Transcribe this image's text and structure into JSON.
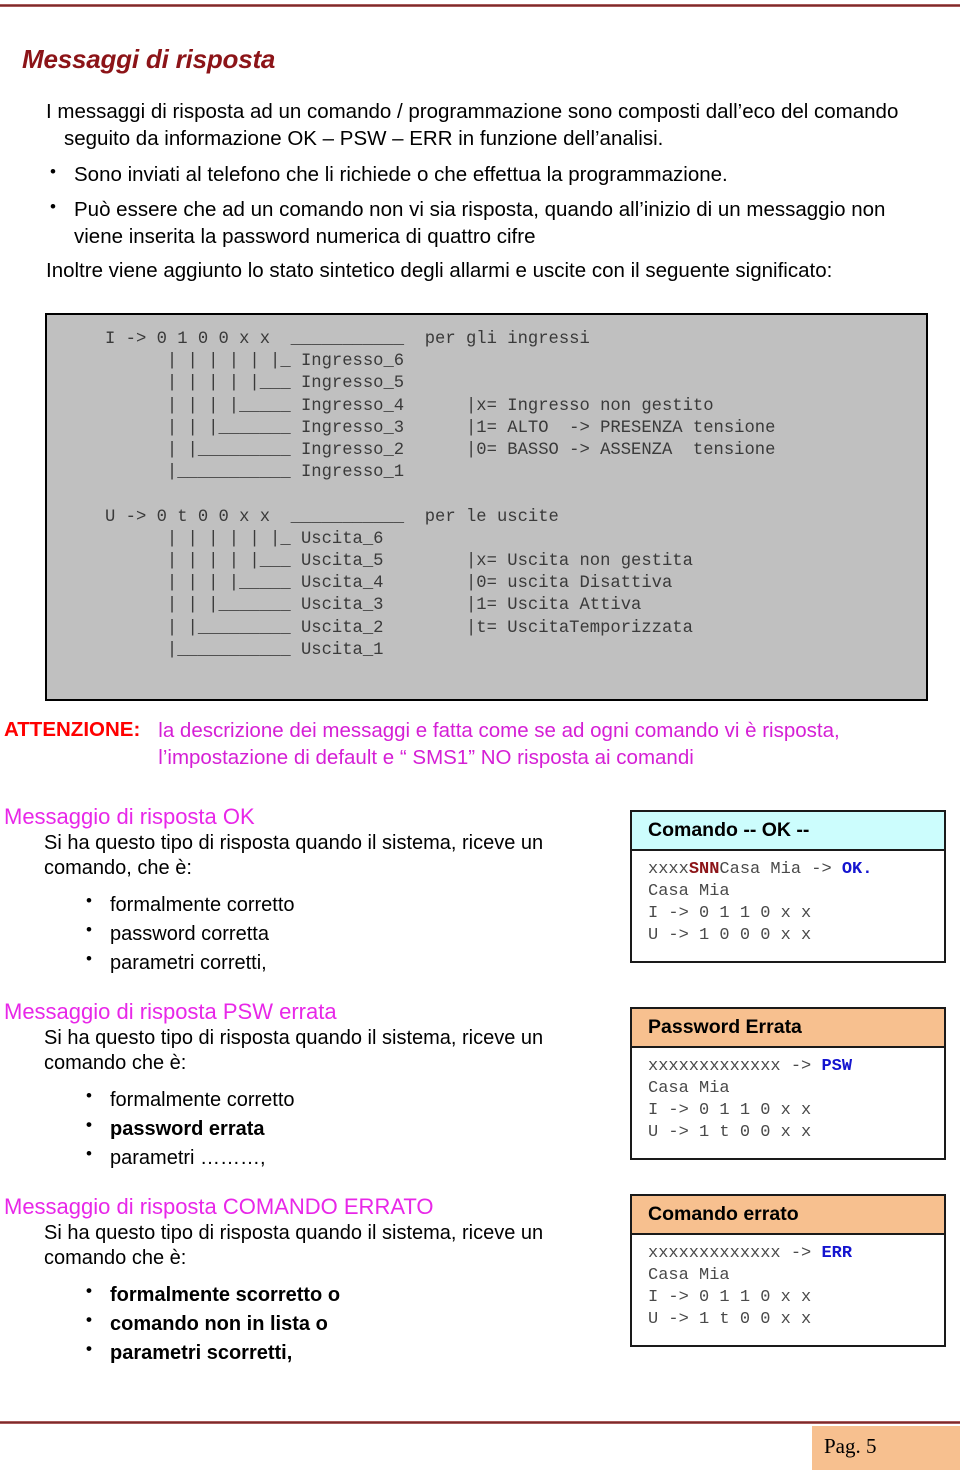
{
  "title": "Messaggi di risposta",
  "intro": {
    "paragraph_line1": "I messaggi di risposta ad un comando / programmazione sono composti dall’eco del comando",
    "paragraph_line2": "seguito da informazione OK – PSW – ERR  in funzione dell’analisi.",
    "bullets": [
      {
        "line1": "Sono inviati al telefono che li richiede o che effettua la programmazione.",
        "line2": ""
      },
      {
        "line1": "Può essere che ad un comando non vi sia risposta, quando all’inizio di un messaggio non",
        "line2": "viene inserita la password numerica di quattro cifre"
      }
    ],
    "closing": "Inoltre viene aggiunto lo stato sintetico degli allarmi e uscite con il seguente significato:"
  },
  "code_block": {
    "text": "I -> 0 1 0 0 x x  ___________  per gli ingressi\n      | | | | | |_ Ingresso_6\n      | | | | |___ Ingresso_5\n      | | | |_____ Ingresso_4      |x= Ingresso non gestito\n      | | |_______ Ingresso_3      |1= ALTO  -> PRESENZA tensione\n      | |_________ Ingresso_2      |0= BASSO -> ASSENZA  tensione\n      |___________ Ingresso_1\n\nU -> 0 t 0 0 x x  ___________  per le uscite\n      | | | | | |_ Uscita_6\n      | | | | |___ Uscita_5        |x= Uscita non gestita\n      | | | |_____ Uscita_4        |0= uscita Disattiva\n      | | |_______ Uscita_3        |1= Uscita Attiva\n      | |_________ Uscita_2        |t= UscitaTemporizzata\n      |___________ Uscita_1"
  },
  "attenzione": {
    "label": "ATTENZIONE:",
    "line1": "la descrizione dei messaggi e fatta come se ad ogni comando vi è risposta,",
    "line2": "l’impostazione di default e “ SMS1”  NO risposta ai comandi"
  },
  "sections": [
    {
      "heading": "Messaggio di risposta OK",
      "desc_line1": "Si ha questo tipo di risposta quando il sistema, riceve un",
      "desc_line2": "comando, che è:",
      "bullets": [
        {
          "text": "formalmente corretto",
          "bold": false
        },
        {
          "text": "password corretta",
          "bold": false
        },
        {
          "text": "parametri corretti,",
          "bold": false
        }
      ],
      "box": {
        "header": "Comando   -- OK --",
        "header_style": "cyan",
        "line1_prefix": "xxxx",
        "line1_accent": "SNN",
        "line1_mid": "Casa Mia -> ",
        "line1_status": "OK.",
        "line2": "Casa Mia",
        "line3": "I -> 0 1 1 0 x x",
        "line4": "U -> 1 0 0 0 x x"
      }
    },
    {
      "heading": "Messaggio di risposta PSW errata",
      "desc_line1": "Si ha questo tipo di risposta quando il sistema, riceve un",
      "desc_line2": "comando che è:",
      "bullets": [
        {
          "text": "formalmente corretto",
          "bold": false
        },
        {
          "text": "password errata",
          "bold": true
        },
        {
          "text": "parametri ………,",
          "bold": false
        }
      ],
      "box": {
        "header": "Password  Errata",
        "header_style": "orange",
        "line1_prefix": "xxxxxxxxxxxxx",
        "line1_accent": "",
        "line1_mid": " -> ",
        "line1_status": "PSW",
        "line2": "Casa Mia",
        "line3": "I -> 0 1 1 0 x x",
        "line4": "U -> 1 t 0 0 x x"
      }
    },
    {
      "heading": "Messaggio di risposta COMANDO ERRATO",
      "desc_line1": "Si ha questo tipo di risposta quando il sistema, riceve un",
      "desc_line2": "comando che è:",
      "bullets": [
        {
          "text": "formalmente scorretto o",
          "bold": true
        },
        {
          "text": "comando non in lista o",
          "bold": true
        },
        {
          "text": "parametri scorretti,",
          "bold": true
        }
      ],
      "box": {
        "header": "Comando errato",
        "header_style": "orange",
        "line1_prefix": "xxxxxxxxxxxxx",
        "line1_accent": "",
        "line1_mid": " -> ",
        "line1_status": "ERR",
        "line2": "Casa Mia",
        "line3": "I -> 0 1 1 0 x x",
        "line4": "U -> 1 t 0 0 x x"
      }
    }
  ],
  "footer": {
    "page_label": "Pag.  5"
  },
  "colors": {
    "title_red": "#8c1418",
    "heading_magenta": "#e827e8",
    "attention_red": "#ff0000",
    "attention_magenta": "#d51fd5",
    "code_bg": "#c0c0c0",
    "box_header_cyan": "#ccfdfd",
    "box_header_orange": "#f7c08f",
    "status_blue": "#1414cf",
    "rule_color": "#7b2b2b"
  }
}
